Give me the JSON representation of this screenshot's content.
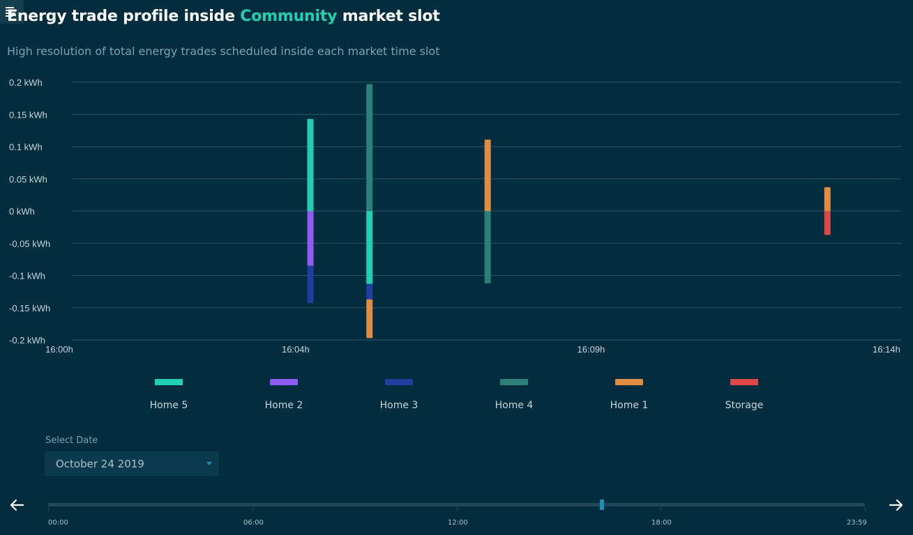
{
  "header": {
    "title_prefix": "Energy trade profile inside ",
    "title_accent": "Community",
    "title_suffix": " market slot",
    "subtitle": "High resolution of total energy trades scheduled inside each market time slot"
  },
  "colors": {
    "background": "#012d3e",
    "accent": "#1fd0b2",
    "grid": "#2e5566",
    "axis_text": "#c8d6dc"
  },
  "chart_data": {
    "type": "bar",
    "stacked": true,
    "y_unit": "kWh",
    "ylim": [
      -0.2,
      0.2
    ],
    "y_ticks": [
      {
        "value": 0.2,
        "label": "0.2 kWh"
      },
      {
        "value": 0.15,
        "label": "0.15 kWh"
      },
      {
        "value": 0.1,
        "label": "0.1 kWh"
      },
      {
        "value": 0.05,
        "label": "0.05 kWh"
      },
      {
        "value": 0,
        "label": "0 kWh"
      },
      {
        "value": -0.05,
        "label": "-0.05 kWh"
      },
      {
        "value": -0.1,
        "label": "-0.1 kWh"
      },
      {
        "value": -0.15,
        "label": "-0.15 kWh"
      },
      {
        "value": -0.2,
        "label": "-0.2 kWh"
      }
    ],
    "x_range_min": [
      0,
      14
    ],
    "x_ticks": [
      {
        "value": 0,
        "label": "16:00h"
      },
      {
        "value": 4,
        "label": "16:04h"
      },
      {
        "value": 9,
        "label": "16:09h"
      },
      {
        "value": 14,
        "label": "16:14h"
      }
    ],
    "series": [
      {
        "name": "Home 5",
        "color": "#1fd0b2"
      },
      {
        "name": "Home 2",
        "color": "#8e5cf2"
      },
      {
        "name": "Home 3",
        "color": "#1f3fa0"
      },
      {
        "name": "Home 4",
        "color": "#2b8178"
      },
      {
        "name": "Home 1",
        "color": "#e08d42"
      },
      {
        "name": "Storage",
        "color": "#e04848"
      }
    ],
    "bars": [
      {
        "time_min": 4.25,
        "segments": [
          {
            "series": "Home 5",
            "value": 0.143
          },
          {
            "series": "Home 2",
            "value": -0.085
          },
          {
            "series": "Home 3",
            "value": -0.058
          }
        ]
      },
      {
        "time_min": 5.25,
        "segments": [
          {
            "series": "Home 4",
            "value": 0.197
          },
          {
            "series": "Home 5",
            "value": -0.113
          },
          {
            "series": "Home 3",
            "value": -0.024
          },
          {
            "series": "Home 1",
            "value": -0.06
          }
        ]
      },
      {
        "time_min": 7.25,
        "segments": [
          {
            "series": "Home 1",
            "value": 0.111
          },
          {
            "series": "Home 4",
            "value": -0.112
          }
        ]
      },
      {
        "time_min": 13.0,
        "segments": [
          {
            "series": "Home 1",
            "value": 0.037
          },
          {
            "series": "Storage",
            "value": -0.037
          }
        ]
      }
    ]
  },
  "legend": {
    "items": [
      "Home 5",
      "Home 2",
      "Home 3",
      "Home 4",
      "Home 1",
      "Storage"
    ]
  },
  "date_picker": {
    "label": "Select Date",
    "value": "October 24 2019"
  },
  "timeline": {
    "ticks": [
      "00:00",
      "06:00",
      "12:00",
      "18:00",
      "23:59"
    ],
    "position_fraction": 0.678,
    "prev_icon": "arrow-left-icon",
    "next_icon": "arrow-right-icon"
  },
  "menu": {
    "icon": "hamburger-menu-icon"
  }
}
